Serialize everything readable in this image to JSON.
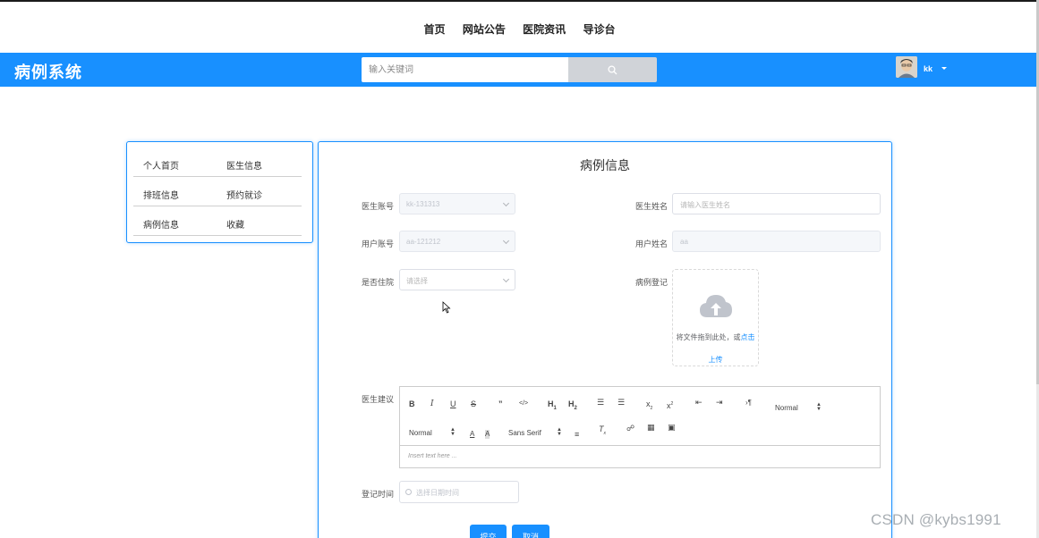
{
  "topnav": {
    "items": [
      "首页",
      "网站公告",
      "医院资讯",
      "导诊台"
    ]
  },
  "header": {
    "logo": "病例系统",
    "search_placeholder": "输入关键词",
    "user_name": "kk",
    "bg_color": "#1890ff"
  },
  "sidebar": {
    "rows": [
      [
        "个人首页",
        "医生信息"
      ],
      [
        "排班信息",
        "预约就诊"
      ],
      [
        "病例信息",
        "收藏"
      ]
    ]
  },
  "form": {
    "title": "病例信息",
    "doctor_account": {
      "label": "医生账号",
      "value": "kk-131313"
    },
    "doctor_name": {
      "label": "医生姓名",
      "placeholder": "请输入医生姓名"
    },
    "user_account": {
      "label": "用户账号",
      "value": "aa-121212"
    },
    "user_name": {
      "label": "用户姓名",
      "value": "aa"
    },
    "hospitalized": {
      "label": "是否住院",
      "placeholder": "请选择"
    },
    "case_register": {
      "label": "病例登记",
      "upload_text": "将文件拖到此处，或",
      "upload_link": "点击",
      "upload_link2": "上传"
    },
    "doctor_advice": {
      "label": "医生建议",
      "toolbar": {
        "header_select": "Normal",
        "size_select": "Normal",
        "font_select": "Sans Serif"
      },
      "editor_placeholder": "Insert text here ..."
    },
    "register_time": {
      "label": "登记时间",
      "placeholder": "选择日期时间"
    },
    "submit_label": "提交",
    "cancel_label": "取消"
  },
  "watermark": "CSDN @kybs1991"
}
